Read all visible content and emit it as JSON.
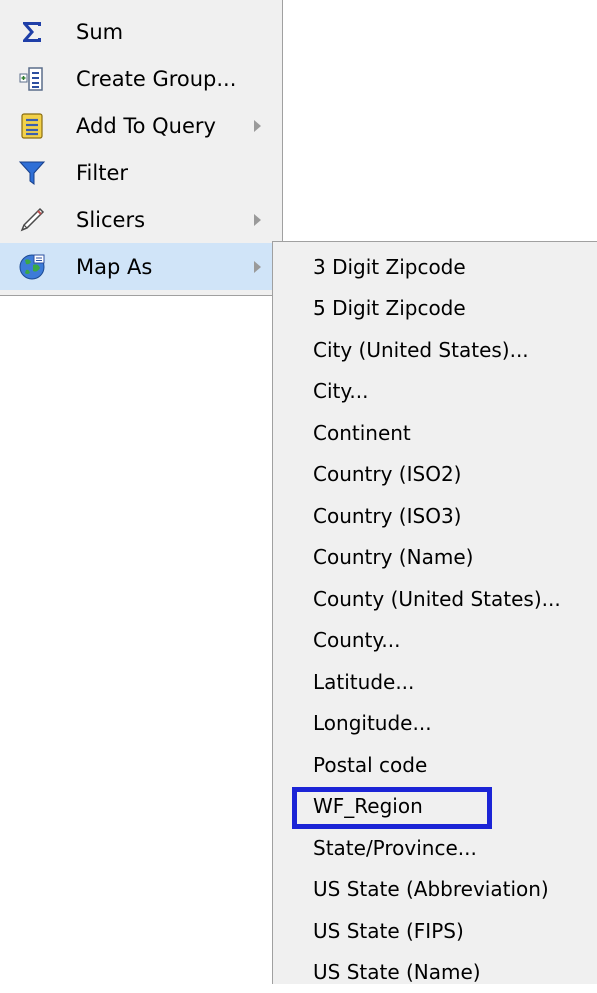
{
  "context_menu": {
    "items": [
      {
        "label": "Sum",
        "icon": "sigma-icon",
        "has_submenu": false
      },
      {
        "label": "Create Group...",
        "icon": "create-group-icon",
        "has_submenu": false
      },
      {
        "label": "Add To Query",
        "icon": "add-to-query-icon",
        "has_submenu": true
      },
      {
        "label": "Filter",
        "icon": "funnel-icon",
        "has_submenu": false
      },
      {
        "label": "Slicers",
        "icon": "pen-icon",
        "has_submenu": true
      },
      {
        "label": "Map As",
        "icon": "globe-icon",
        "has_submenu": true,
        "highlighted": true
      }
    ]
  },
  "map_as_submenu": {
    "items": [
      "3 Digit Zipcode",
      "5 Digit Zipcode",
      "City (United States)...",
      "City...",
      "Continent",
      "Country (ISO2)",
      "Country (ISO3)",
      "Country (Name)",
      "County (United States)...",
      "County...",
      "Latitude...",
      "Longitude...",
      "Postal code",
      "WF_Region",
      "State/Province...",
      "US State (Abbreviation)",
      "US State (FIPS)",
      "US State (Name)"
    ],
    "selected_item": "WF_Region"
  },
  "colors": {
    "menu_background": "#f0f0f0",
    "highlight": "#d0e4f8",
    "selection_border": "#1b24d6"
  }
}
